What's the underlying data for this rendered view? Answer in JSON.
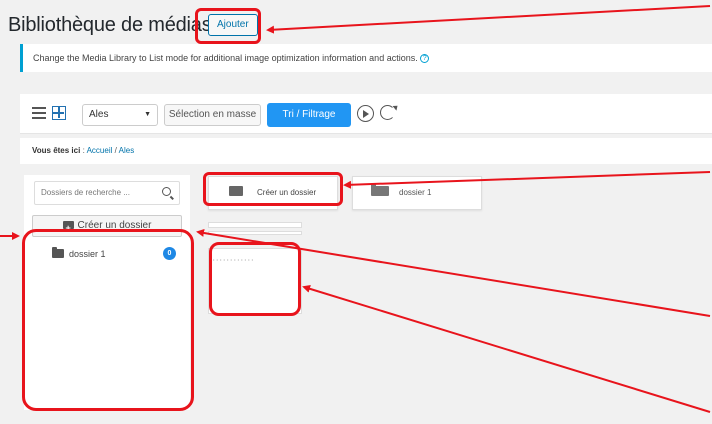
{
  "header": {
    "title": "Bibliothèque de médias",
    "add_label": "Ajouter"
  },
  "notice": {
    "text": "Change the Media Library to List mode for additional image optimization information and actions."
  },
  "toolbar": {
    "filter_select_value": "Ales",
    "bulk_select_label": "Sélection en masse",
    "filter_button_label": "Tri / Filtrage"
  },
  "breadcrumb": {
    "label": "Vous êtes ici",
    "separator1": ":",
    "home": "Accueil",
    "separator2": "/",
    "current": "Ales"
  },
  "sidebar": {
    "search_placeholder": "Dossiers de recherche ...",
    "create_folder_label": "Créer un dossier",
    "folders": [
      {
        "name": "dossier 1",
        "count": "0"
      }
    ]
  },
  "grid": {
    "create_folder_label": "Créer un dossier",
    "folder_name": "dossier 1"
  },
  "colors": {
    "accent": "#2196f3",
    "annotation": "#e8141c",
    "notice_border": "#00a0d2"
  }
}
